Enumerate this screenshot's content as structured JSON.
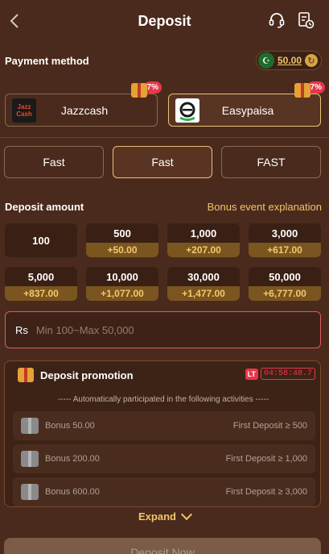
{
  "header": {
    "title": "Deposit"
  },
  "payment": {
    "label": "Payment method",
    "balance": "50.00",
    "methods": [
      {
        "name": "Jazzcash",
        "logo_text": "Jazz Cash",
        "badge": "7%",
        "selected": false
      },
      {
        "name": "Easypaisa",
        "badge": "7%",
        "selected": true
      }
    ]
  },
  "channels": [
    {
      "label": "Fast",
      "selected": false
    },
    {
      "label": "Fast",
      "selected": true
    },
    {
      "label": "FAST",
      "selected": false
    }
  ],
  "deposit": {
    "label": "Deposit amount",
    "bonus_link": "Bonus event explanation",
    "amounts": [
      {
        "value": "100",
        "bonus": ""
      },
      {
        "value": "500",
        "bonus": "+50.00"
      },
      {
        "value": "1,000",
        "bonus": "+207.00"
      },
      {
        "value": "3,000",
        "bonus": "+617.00"
      },
      {
        "value": "5,000",
        "bonus": "+837.00"
      },
      {
        "value": "10,000",
        "bonus": "+1,077.00"
      },
      {
        "value": "30,000",
        "bonus": "+1,477.00"
      },
      {
        "value": "50,000",
        "bonus": "+6,777.00"
      }
    ],
    "currency": "Rs",
    "placeholder": "Min 100~Max 50,000"
  },
  "promotion": {
    "title": "Deposit promotion",
    "timer_badge": "LT",
    "timer": "04:58:48.7",
    "auto_text": "----- Automatically participated in the following activities -----",
    "bonuses": [
      {
        "name": "Bonus 50.00",
        "condition": "First Deposit ≥ 500"
      },
      {
        "name": "Bonus 200.00",
        "condition": "First Deposit ≥ 1,000"
      },
      {
        "name": "Bonus 600.00",
        "condition": "First Deposit ≥ 3,000"
      }
    ],
    "expand_label": "Expand"
  },
  "cta": {
    "label": "Deposit Now"
  },
  "colors": {
    "background": "#4a2a1c",
    "accent": "#f1c46b",
    "error_border": "#e25a5a",
    "badge": "#e8364a"
  }
}
